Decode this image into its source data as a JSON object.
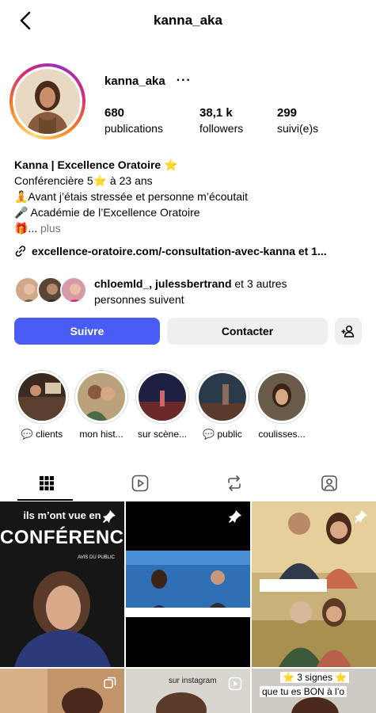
{
  "header": {
    "title": "kanna_aka"
  },
  "profile": {
    "username": "kanna_aka",
    "more": "···",
    "stats": [
      {
        "value": "680",
        "label": "publications"
      },
      {
        "value": "38,1 k",
        "label": "followers"
      },
      {
        "value": "299",
        "label": "suivi(e)s"
      }
    ]
  },
  "bio": {
    "name": "Kanna | Excellence Oratoire ⭐",
    "line1": "Conférencière 5⭐ à 23 ans",
    "line2": "🧘Avant j’étais stressée et personne m’écoutait",
    "line3": "🎤 Académie de l’Excellence Oratoire",
    "line4_prefix": "🎁...",
    "line4_more": "plus",
    "link": "excellence-oratoire.com/-consultation-avec-kanna et 1..."
  },
  "followed_by": {
    "names": "chloemld_, julessbertrand",
    "rest": "et 3 autres",
    "line2": "personnes suivent"
  },
  "buttons": {
    "follow": "Suivre",
    "contact": "Contacter"
  },
  "highlights": [
    {
      "label": "💬 clients"
    },
    {
      "label": "mon hist..."
    },
    {
      "label": "sur scène..."
    },
    {
      "label": "💬 public"
    },
    {
      "label": "coulisses..."
    }
  ],
  "posts": {
    "p1_line1": "ils m’ont vue en",
    "p1_line2": "CONFÉRENCE",
    "p1_small": "AVIS DU PUBLIC",
    "p5_badge": "sur instagram",
    "p6_line1": "⭐ 3 signes ⭐",
    "p6_line2": "que tu es BON à l’o"
  },
  "colors": {
    "follow": "#4a5cf6",
    "secondary": "#efefef"
  }
}
